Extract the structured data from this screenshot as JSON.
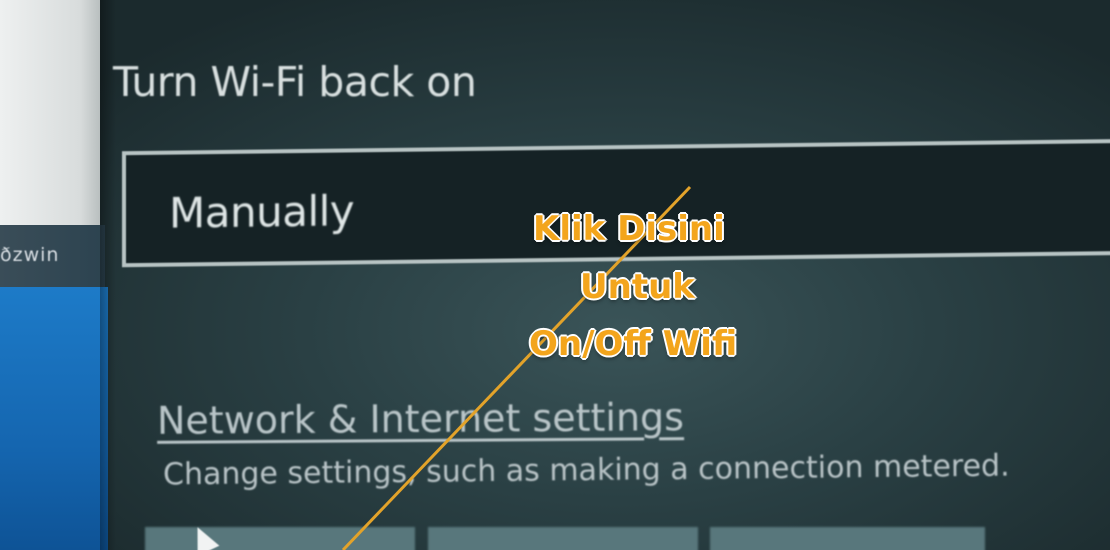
{
  "background_window": {
    "label": "ðzwin"
  },
  "wifi_panel": {
    "heading": "Turn Wi-Fi back on",
    "dropdown_value": "Manually",
    "settings_link": "Network & Internet settings",
    "settings_description": "Change settings, such as making a connection metered."
  },
  "annotation": {
    "line_1": "Klik Disini",
    "line_2": "Untuk",
    "line_3": "On/Off Wifi",
    "color": "#f3a51c",
    "outline_color": "#ffffff"
  }
}
